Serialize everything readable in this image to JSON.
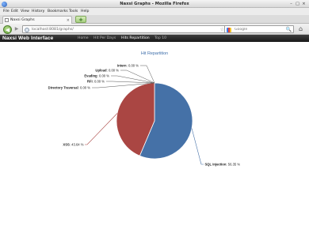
{
  "window": {
    "title": "Naxsi Graphs - Mozilla Firefox",
    "controls": [
      "–",
      "□",
      "×"
    ]
  },
  "menubar": [
    "File",
    "Edit",
    "View",
    "History",
    "Bookmarks",
    "Tools",
    "Help"
  ],
  "tab": {
    "label": "Naxsi Graphs",
    "close": "×"
  },
  "new_tab_label": "+",
  "navbar": {
    "back": "◀",
    "forward": "▶",
    "url_prefix": "localhost",
    "url_domain": "",
    "url_rest": ":8081/graphs/",
    "star": "☆",
    "reload": "↻",
    "search_placeholder": "Google",
    "search_icon": "🔍",
    "home": "⌂"
  },
  "app": {
    "brand": "Naxsi Web Interface",
    "nav": [
      {
        "label": "Home",
        "active": false
      },
      {
        "label": "Hit Per Days",
        "active": false
      },
      {
        "label": "Hits Repartition",
        "active": true
      },
      {
        "label": "Top 10",
        "active": false
      }
    ]
  },
  "chart_data": {
    "type": "pie",
    "title": "Hit Repartition",
    "unit": "%",
    "slices": [
      {
        "name": "SQL Injection",
        "value": 56.35,
        "label": "56.35 %",
        "color": "#4571a7"
      },
      {
        "name": "XSS",
        "value": 43.64,
        "label": "43.64 %",
        "color": "#aa4643"
      },
      {
        "name": "Directory Traversal",
        "value": 0.0,
        "label": "0.00 %",
        "color": "#89a54e"
      },
      {
        "name": "RFI",
        "value": 0.0,
        "label": "0.00 %",
        "color": "#80699b"
      },
      {
        "name": "Evading",
        "value": 0.0,
        "label": "0.00 %",
        "color": "#3d96ae"
      },
      {
        "name": "Upload",
        "value": 0.0,
        "label": "0.00 %",
        "color": "#db843d"
      },
      {
        "name": "Intern",
        "value": 0.0,
        "label": "0.00 %",
        "color": "#92a8cd"
      }
    ],
    "grid": false,
    "legend": "none"
  },
  "colors": {
    "header_bg": "#2b2b2b",
    "title_blue": "#3d6eaa",
    "sql_injection": "#4571a7",
    "xss": "#aa4643"
  },
  "icons": {
    "app": "firefox-icon",
    "tab": "page-icon",
    "back": "back-arrow-icon",
    "search_engine": "google-icon",
    "home": "home-icon"
  }
}
